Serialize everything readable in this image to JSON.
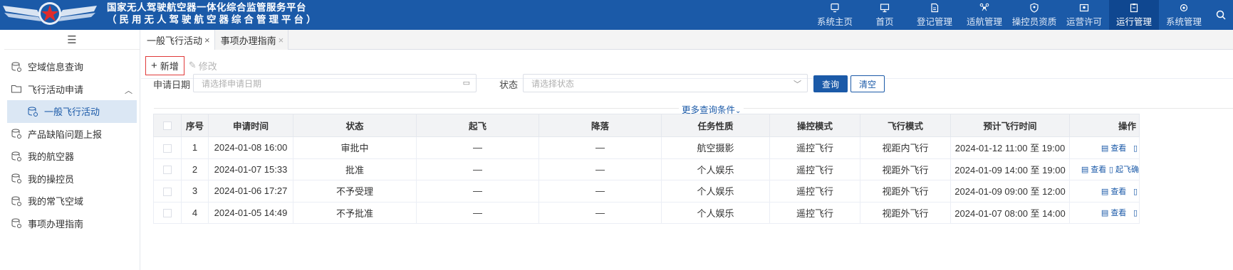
{
  "header": {
    "title_line1": "国家无人驾驶航空器一体化综合监管服务平台",
    "title_line2": "（民用无人驾驶航空器综合管理平台）",
    "brand_color": "#1b5aa8",
    "nav": [
      {
        "label": "系统主页",
        "icon": "home-screen-icon"
      },
      {
        "label": "首页",
        "icon": "monitor-icon"
      },
      {
        "label": "登记管理",
        "icon": "document-icon"
      },
      {
        "label": "适航管理",
        "icon": "drone-icon"
      },
      {
        "label": "操控员资质",
        "icon": "shield-user-icon"
      },
      {
        "label": "运营许可",
        "icon": "license-icon"
      },
      {
        "label": "运行管理",
        "icon": "clipboard-icon",
        "active": true
      },
      {
        "label": "系统管理",
        "icon": "settings-icon"
      }
    ]
  },
  "sidebar": {
    "items": [
      {
        "label": "空域信息查询"
      },
      {
        "label": "飞行活动申请"
      },
      {
        "label": "一般飞行活动"
      },
      {
        "label": "产品缺陷问题上报"
      },
      {
        "label": "我的航空器"
      },
      {
        "label": "我的操控员"
      },
      {
        "label": "我的常飞空域"
      },
      {
        "label": "事项办理指南"
      }
    ]
  },
  "tabs": [
    {
      "label": "一般飞行活动"
    },
    {
      "label": "事项办理指南"
    }
  ],
  "toolbar": {
    "add_label": "新增",
    "edit_label": "修改"
  },
  "search": {
    "date_label": "申请日期",
    "date_placeholder": "请选择申请日期",
    "status_label": "状态",
    "status_placeholder": "请选择状态",
    "query_label": "查询",
    "clear_label": "清空",
    "more_label": "更多查询条件"
  },
  "table": {
    "headers": [
      "序号",
      "申请时间",
      "状态",
      "起飞",
      "降落",
      "任务性质",
      "操控模式",
      "飞行模式",
      "预计飞行时间",
      "操作"
    ],
    "rows": [
      {
        "no": "1",
        "time": "2024-01-08 16:00",
        "status": "审批中",
        "takeoff": "—",
        "landing": "—",
        "nature": "航空摄影",
        "control": "遥控飞行",
        "flight": "视距内飞行",
        "planned": "2024-01-12 11:00 至 19:00",
        "op": "查看"
      },
      {
        "no": "2",
        "time": "2024-01-07 15:33",
        "status": "批准",
        "takeoff": "—",
        "landing": "—",
        "nature": "个人娱乐",
        "control": "遥控飞行",
        "flight": "视距外飞行",
        "planned": "2024-01-09 14:00 至 19:00",
        "op": "查看",
        "op2": "起飞确"
      },
      {
        "no": "3",
        "time": "2024-01-06 17:27",
        "status": "不予受理",
        "takeoff": "—",
        "landing": "—",
        "nature": "个人娱乐",
        "control": "遥控飞行",
        "flight": "视距外飞行",
        "planned": "2024-01-09 09:00 至 12:00",
        "op": "查看"
      },
      {
        "no": "4",
        "time": "2024-01-05 14:49",
        "status": "不予批准",
        "takeoff": "—",
        "landing": "—",
        "nature": "个人娱乐",
        "control": "遥控飞行",
        "flight": "视距外飞行",
        "planned": "2024-01-07 08:00 至 14:00",
        "op": "查看"
      }
    ]
  }
}
